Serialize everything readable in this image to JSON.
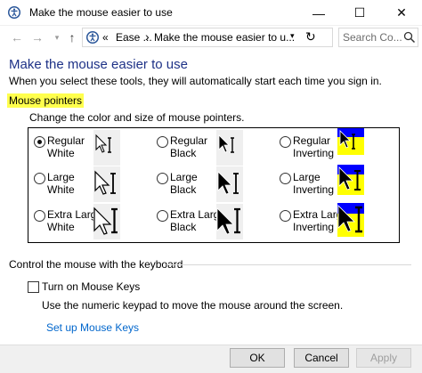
{
  "window": {
    "title": "Make the mouse easier to use",
    "controls": {
      "minimize": "—",
      "maximize": "☐",
      "close": "✕"
    }
  },
  "address": {
    "prefix": "«",
    "segment1": "Ease ...",
    "separator": "›",
    "segment2": "Make the mouse easier to u...",
    "search_placeholder": "Search Co..."
  },
  "page": {
    "heading": "Make the mouse easier to use",
    "subheading": "When you select these tools, they will automatically start each time you sign in.",
    "mouse_pointers": {
      "label": "Mouse pointers",
      "description": "Change the color and size of mouse pointers.",
      "options": [
        {
          "line1": "Regular",
          "line2": "White",
          "selected": true,
          "style": "white",
          "size": "regular"
        },
        {
          "line1": "Regular",
          "line2": "Black",
          "selected": false,
          "style": "black",
          "size": "regular"
        },
        {
          "line1": "Regular",
          "line2": "Inverting",
          "selected": false,
          "style": "inverting",
          "size": "regular"
        },
        {
          "line1": "Large",
          "line2": "White",
          "selected": false,
          "style": "white",
          "size": "large"
        },
        {
          "line1": "Large",
          "line2": "Black",
          "selected": false,
          "style": "black",
          "size": "large"
        },
        {
          "line1": "Large",
          "line2": "Inverting",
          "selected": false,
          "style": "inverting",
          "size": "large"
        },
        {
          "line1": "Extra Large",
          "line2": "White",
          "selected": false,
          "style": "white",
          "size": "xlarge"
        },
        {
          "line1": "Extra Large",
          "line2": "Black",
          "selected": false,
          "style": "black",
          "size": "xlarge"
        },
        {
          "line1": "Extra Large",
          "line2": "Inverting",
          "selected": false,
          "style": "inverting",
          "size": "xlarge"
        }
      ]
    },
    "keyboard": {
      "label": "Control the mouse with the keyboard",
      "mouse_keys_label": "Turn on Mouse Keys",
      "mouse_keys_checked": false,
      "description": "Use the numeric keypad to move the mouse around the screen.",
      "setup_link": "Set up Mouse Keys"
    }
  },
  "buttons": {
    "ok": "OK",
    "cancel": "Cancel",
    "apply": "Apply"
  },
  "colors": {
    "heading": "#1e3287",
    "highlight": "#ffff4d",
    "link": "#0066cc",
    "inverting_blue": "#0000ff",
    "inverting_yellow": "#ffff00"
  }
}
